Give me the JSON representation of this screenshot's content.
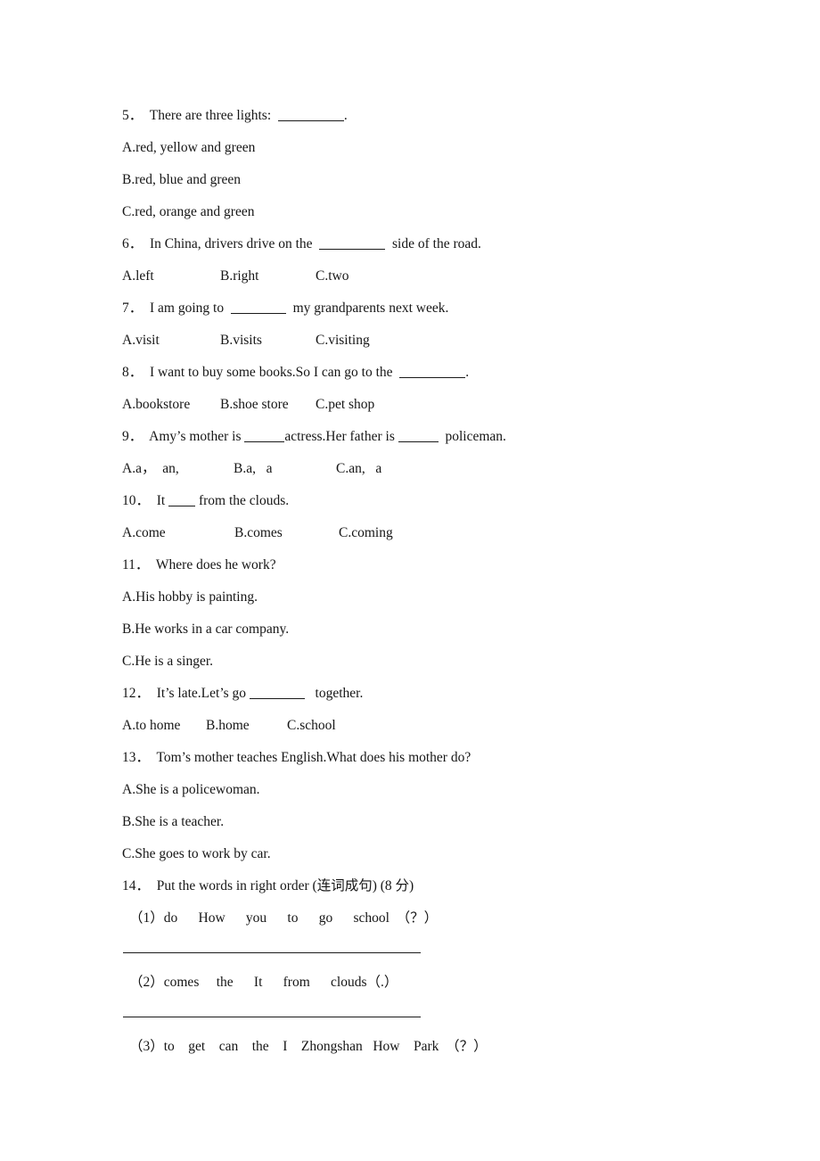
{
  "document": {
    "type": "exam-worksheet",
    "language": "en-zh",
    "questions": [
      {
        "number": "5",
        "stem_before": "5．  There are three lights:  ",
        "blank": "w-lg",
        "stem_after": ".",
        "options_layout": "stacked",
        "options": [
          "A.red, yellow and green",
          "B.red, blue and green",
          "C.red, orange and green"
        ]
      },
      {
        "number": "6",
        "stem_before": "6．  In China, drivers drive on the  ",
        "blank": "w-lg",
        "stem_after": "  side of the road.",
        "options_layout": "inline",
        "options": [
          "A.left",
          "B.right",
          "C.two"
        ]
      },
      {
        "number": "7",
        "stem_before": "7．  I am going to  ",
        "blank": "w-md",
        "stem_after": "  my grandparents next week.",
        "options_layout": "inline",
        "options": [
          "A.visit",
          "B.visits",
          "C.visiting"
        ]
      },
      {
        "number": "8",
        "stem_before": "8．  I want to buy some books.So I can go to the  ",
        "blank": "w-lg",
        "stem_after": ".",
        "options_layout": "inline",
        "options": [
          "A.bookstore",
          "B.shoe store",
          "C.pet shop"
        ]
      },
      {
        "number": "9",
        "stem_before": "9．  Amy’s mother is ",
        "blank": "w-sm",
        "stem_mid": "actress.Her father is ",
        "blank2": "w-sm",
        "stem_after": "  policeman.",
        "options_layout": "inline",
        "options": [
          "A.a，  an,",
          "B.a,   a",
          "C.an,   a"
        ]
      },
      {
        "number": "10",
        "stem_before": "10．  It ",
        "blank": "w-xs",
        "stem_after": " from the clouds.",
        "options_layout": "inline",
        "options": [
          "A.come",
          "B.comes",
          "C.coming"
        ]
      },
      {
        "number": "11",
        "stem_before": "11．  Where does he work?",
        "options_layout": "stacked",
        "options": [
          "A.His hobby is painting.",
          "B.He works in a car company.",
          "C.He is a singer."
        ]
      },
      {
        "number": "12",
        "stem_before": "12．  It’s late.Let’s go ",
        "blank": "w-md",
        "stem_after": "   together.",
        "options_layout": "inline",
        "options": [
          "A.to home",
          "B.home",
          "C.school"
        ]
      },
      {
        "number": "13",
        "stem_before": "13．  Tom’s mother teaches English.What does his mother do?",
        "options_layout": "stacked",
        "options": [
          "A.She is a policewoman.",
          "B.She is a teacher.",
          "C.She goes to work by car."
        ]
      },
      {
        "number": "14",
        "stem_before": "14．  Put the words in right order (连词成句) (8 分)",
        "options_layout": "reorder",
        "subitems": [
          {
            "label": "（1）",
            "words": "do      How      you      to      go      school  （？）",
            "has_rule": true
          },
          {
            "label": "（2）",
            "words": "comes     the      It      from      clouds（.）",
            "has_rule": true
          },
          {
            "label": "（3）",
            "words": "to    get    can    the    I    Zhongshan   How    Park  （？）",
            "has_rule": false
          }
        ]
      }
    ]
  },
  "lines": {
    "q5_stem_a": "5．  There are three lights:  ",
    "q5_stem_b": ".",
    "q5_opt_a": "A.red, yellow and green",
    "q5_opt_b": "B.red, blue and green",
    "q5_opt_c": "C.red, orange and green",
    "q6_stem_a": "6．  In China, drivers drive on the  ",
    "q6_stem_b": "  side of the road.",
    "q6_opt_a": "A.left",
    "q6_opt_b": "B.right",
    "q6_opt_c": "C.two",
    "q7_stem_a": "7．  I am going to  ",
    "q7_stem_b": "  my grandparents next week.",
    "q7_opt_a": "A.visit",
    "q7_opt_b": "B.visits",
    "q7_opt_c": "C.visiting",
    "q8_stem_a": "8．  I want to buy some books.So I can go to the  ",
    "q8_stem_b": ".",
    "q8_opt_a": "A.bookstore",
    "q8_opt_b": "B.shoe store",
    "q8_opt_c": "C.pet shop",
    "q9_stem_a": "9．  Amy’s mother is ",
    "q9_stem_b": "actress.Her father is ",
    "q9_stem_c": "  policeman.",
    "q9_opt_a": "A.a，  an,",
    "q9_opt_b": "B.a,   a",
    "q9_opt_c": "C.an,   a",
    "q10_stem_a": "10．  It ",
    "q10_stem_b": " from the clouds.",
    "q10_opt_a": "A.come",
    "q10_opt_b": "B.comes",
    "q10_opt_c": "C.coming",
    "q11_stem": "11．  Where does he work?",
    "q11_opt_a": "A.His hobby is painting.",
    "q11_opt_b": "B.He works in a car company.",
    "q11_opt_c": "C.He is a singer.",
    "q12_stem_a": "12．  It’s late.Let’s go ",
    "q12_stem_b": "   together.",
    "q12_opt_a": "A.to home",
    "q12_opt_b": "B.home",
    "q12_opt_c": "C.school",
    "q13_stem": "13．  Tom’s mother teaches English.What does his mother do?",
    "q13_opt_a": "A.She is a policewoman.",
    "q13_opt_b": "B.She is a teacher.",
    "q13_opt_c": "C.She goes to work by car.",
    "q14_stem": "14．  Put the words in right order (连词成句) (8 分)",
    "q14_item1": "（1）do      How      you      to      go      school  （？）",
    "q14_item2": "（2）comes     the      It      from      clouds（.）",
    "q14_item3": "（3）to    get    can    the    I    Zhongshan   How    Park  （？）"
  }
}
